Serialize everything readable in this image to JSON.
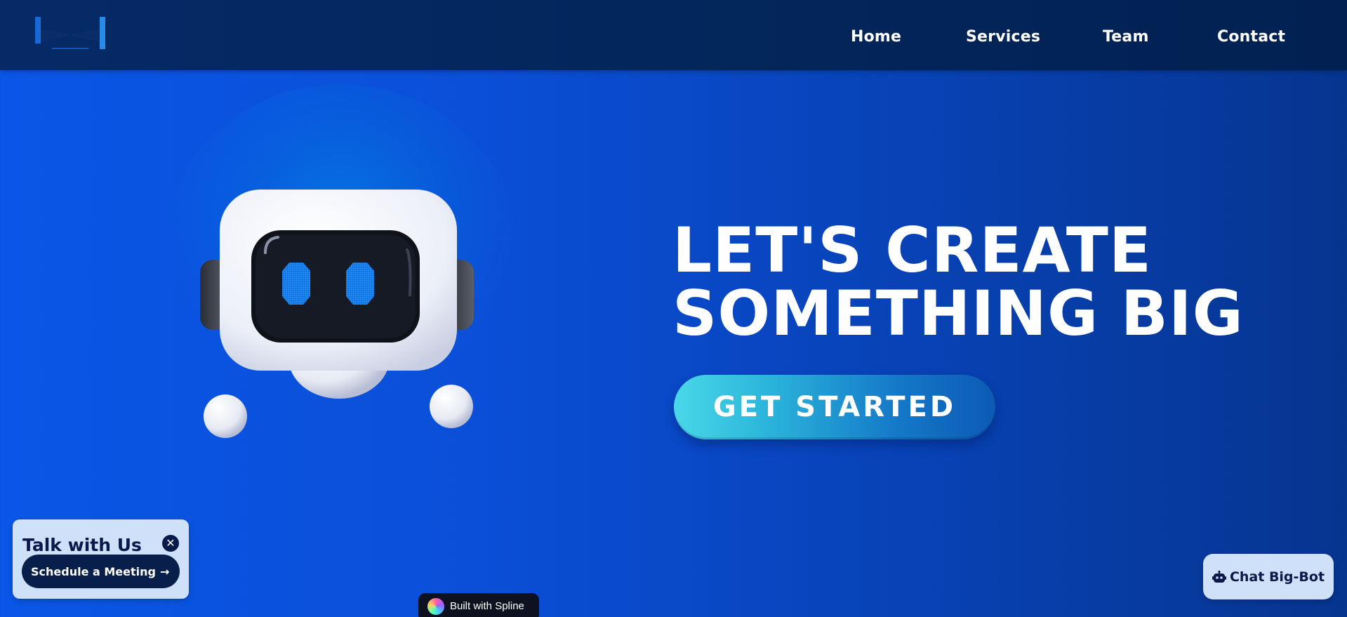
{
  "header": {
    "logo_icon": "bm-logo-icon",
    "nav": [
      {
        "label": "Home"
      },
      {
        "label": "Services"
      },
      {
        "label": "Team"
      },
      {
        "label": "Contact"
      }
    ]
  },
  "hero": {
    "title_line1": "LET'S CREATE",
    "title_line2": "SOMETHING BIG",
    "cta_label": "GET STARTED",
    "robot_icon": "robot-illustration"
  },
  "talk_card": {
    "title": "Talk with Us",
    "close_icon": "close-icon",
    "meeting_label": "Schedule a Meeting",
    "arrow_icon": "arrow-right-icon"
  },
  "spline_badge": {
    "label": "Built with Spline"
  },
  "chatbot": {
    "label": "Chat Big-Bot",
    "icon": "robot-icon"
  },
  "colors": {
    "header_bg": "#03265c",
    "body_bg_start": "#0a56e6",
    "body_bg_end": "#063590",
    "card_bg": "#cfe0f9",
    "dark_navy": "#071a4a",
    "cta_start": "#49d8e8",
    "cta_end": "#0c5ab4",
    "robot_eye": "#1e8cff"
  }
}
